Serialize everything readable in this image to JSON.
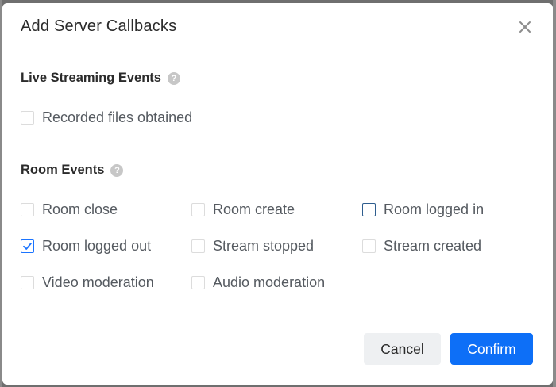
{
  "dialog": {
    "title": "Add Server Callbacks",
    "close_icon": "close-icon"
  },
  "live_streaming": {
    "title": "Live Streaming Events",
    "help_icon": "?",
    "items": [
      {
        "label": "Recorded files obtained",
        "checked": false
      }
    ]
  },
  "room_events": {
    "title": "Room Events",
    "help_icon": "?",
    "items": [
      {
        "label": "Room close",
        "checked": false
      },
      {
        "label": "Room create",
        "checked": false
      },
      {
        "label": "Room logged in",
        "checked": false,
        "focused": true
      },
      {
        "label": "Room logged out",
        "checked": true
      },
      {
        "label": "Stream stopped",
        "checked": false
      },
      {
        "label": "Stream created",
        "checked": false
      },
      {
        "label": "Video moderation",
        "checked": false
      },
      {
        "label": "Audio moderation",
        "checked": false
      }
    ]
  },
  "footer": {
    "cancel_label": "Cancel",
    "confirm_label": "Confirm"
  },
  "colors": {
    "primary": "#0d6ff7",
    "checkbox_border": "#dcdcdc",
    "text": "#555a60"
  }
}
